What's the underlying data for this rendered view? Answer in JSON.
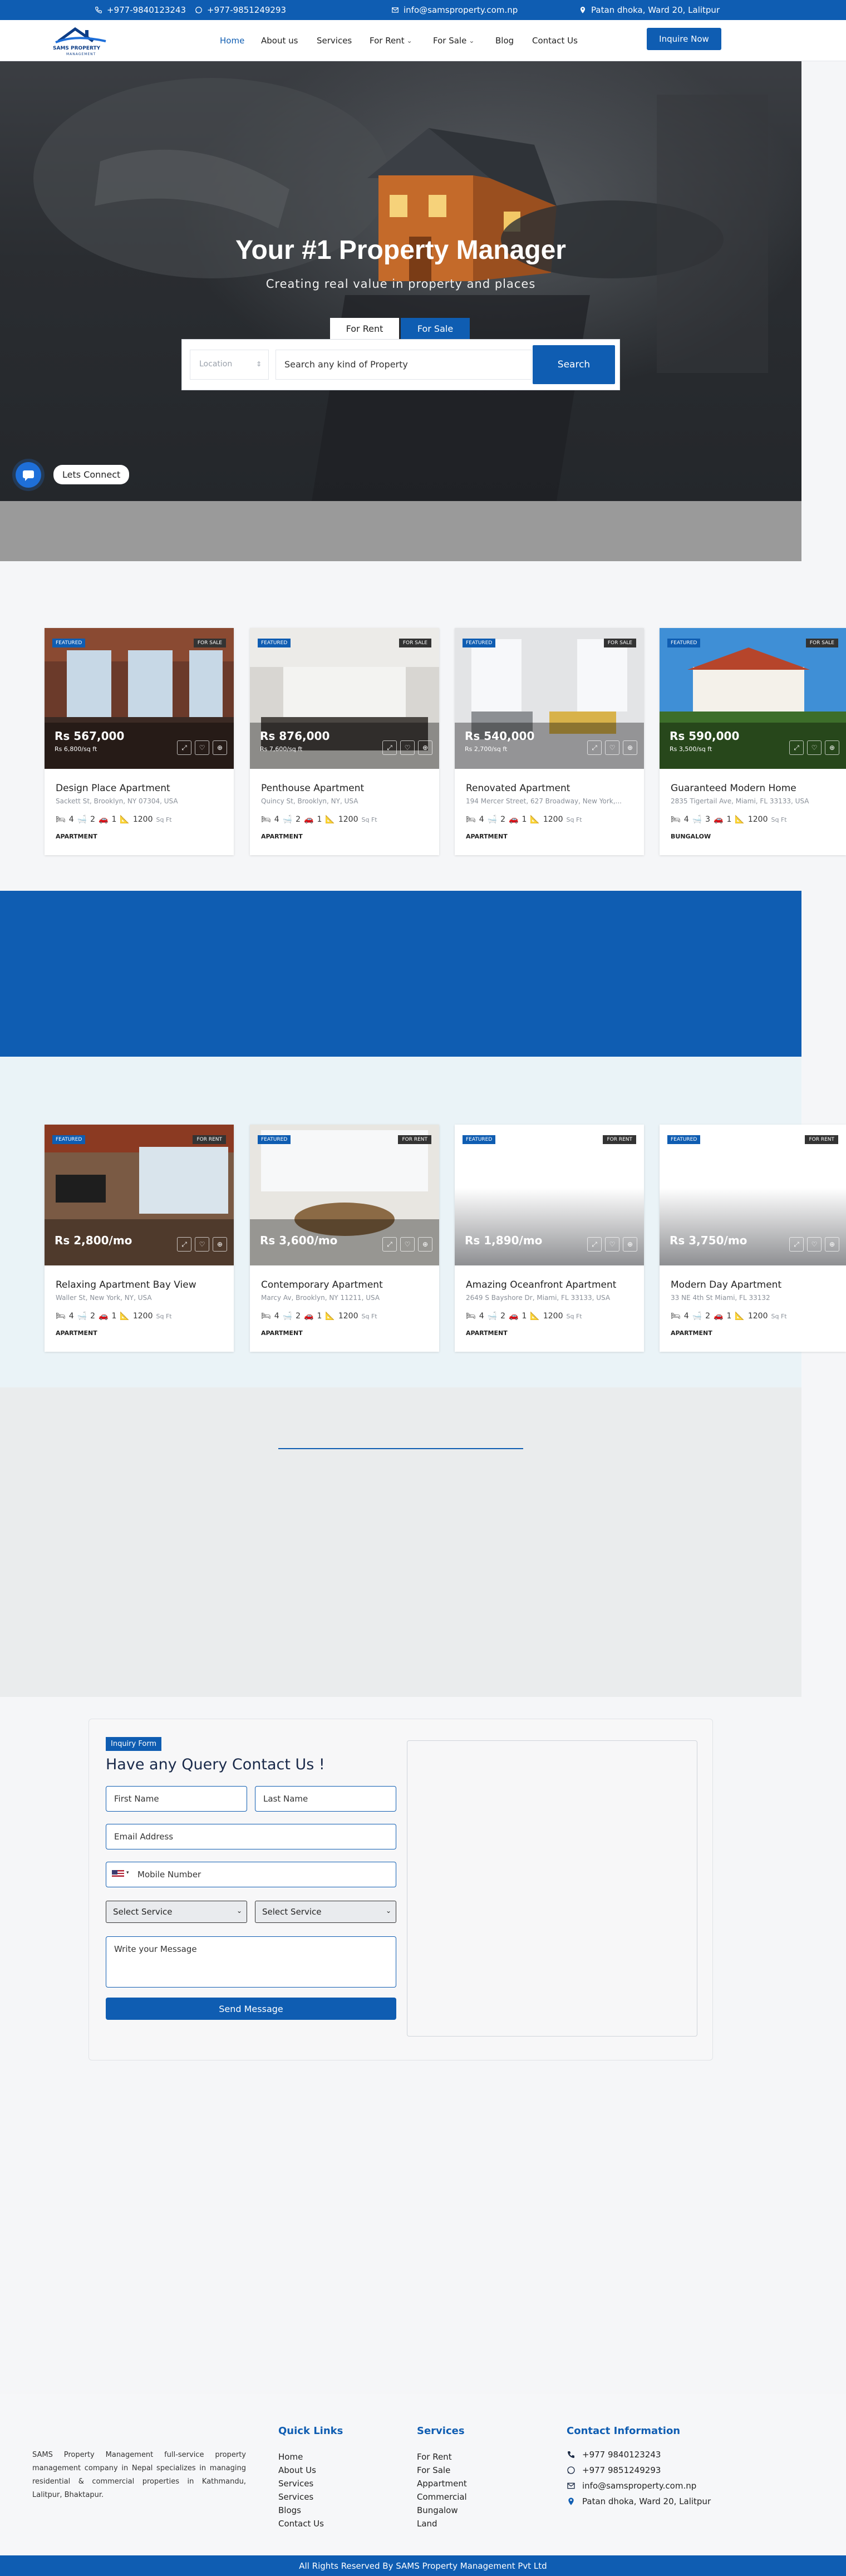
{
  "topbar": {
    "phone1": "+977-9840123243",
    "phone2": "+977-9851249293",
    "email": "info@samsproperty.com.np",
    "address": "Patan dhoka, Ward 20, Lalitpur"
  },
  "nav": {
    "logo_text": "SAMS PROPERTY",
    "logo_subtext": "MANAGEMENT",
    "items": [
      "Home",
      "About us",
      "Services",
      "For Rent",
      "For Sale",
      "Blog",
      "Contact Us"
    ],
    "inquire_label": "Inquire Now"
  },
  "hero": {
    "title": "Your #1 Property Manager",
    "subtitle": "Creating real value in property and places",
    "tab_rent": "For Rent",
    "tab_sale": "For Sale",
    "location_placeholder": "Location",
    "search_placeholder": "Search any kind of Property",
    "search_button": "Search",
    "connect_label": "Lets Connect"
  },
  "sale_listings": [
    {
      "featured": "FEATURED",
      "type": "FOR SALE",
      "price": "Rs 567,000",
      "sqft": "Rs 6,800/sq ft",
      "title": "Design Place Apartment",
      "address": "Sackett St, Brooklyn, NY 07304, USA",
      "beds": "4",
      "baths": "2",
      "garage": "1",
      "area": "1200",
      "unit": "Sq Ft",
      "category": "APARTMENT"
    },
    {
      "featured": "FEATURED",
      "type": "FOR SALE",
      "price": "Rs 876,000",
      "sqft": "Rs 7,600/sq ft",
      "title": "Penthouse Apartment",
      "address": "Quincy St, Brooklyn, NY, USA",
      "beds": "4",
      "baths": "2",
      "garage": "1",
      "area": "1200",
      "unit": "Sq Ft",
      "category": "APARTMENT"
    },
    {
      "featured": "FEATURED",
      "type": "FOR SALE",
      "price": "Rs 540,000",
      "sqft": "Rs 2,700/sq ft",
      "title": "Renovated Apartment",
      "address": "194 Mercer Street, 627 Broadway, New York,...",
      "beds": "4",
      "baths": "2",
      "garage": "1",
      "area": "1200",
      "unit": "Sq Ft",
      "category": "APARTMENT"
    },
    {
      "featured": "FEATURED",
      "type": "FOR SALE",
      "price": "Rs 590,000",
      "sqft": "Rs 3,500/sq ft",
      "title": "Guaranteed Modern Home",
      "address": "2835 Tigertail Ave, Miami, FL 33133, USA",
      "beds": "4",
      "baths": "3",
      "garage": "1",
      "area": "1200",
      "unit": "Sq Ft",
      "category": "BUNGALOW"
    }
  ],
  "rent_listings": [
    {
      "featured": "FEATURED",
      "type": "FOR RENT",
      "price": "Rs 2,800/mo",
      "title": "Relaxing Apartment Bay View",
      "address": "Waller St, New York, NY, USA",
      "beds": "4",
      "baths": "2",
      "garage": "1",
      "area": "1200",
      "unit": "Sq Ft",
      "category": "APARTMENT"
    },
    {
      "featured": "FEATURED",
      "type": "FOR RENT",
      "price": "Rs 3,600/mo",
      "title": "Contemporary Apartment",
      "address": "Marcy Av, Brooklyn, NY 11211, USA",
      "beds": "4",
      "baths": "2",
      "garage": "1",
      "area": "1200",
      "unit": "Sq Ft",
      "category": "APARTMENT"
    },
    {
      "featured": "FEATURED",
      "type": "FOR RENT",
      "price": "Rs 1,890/mo",
      "title": "Amazing Oceanfront Apartment",
      "address": "2649 S Bayshore Dr, Miami, FL 33133, USA",
      "beds": "4",
      "baths": "2",
      "garage": "1",
      "area": "1200",
      "unit": "Sq Ft",
      "category": "APARTMENT"
    },
    {
      "featured": "FEATURED",
      "type": "FOR RENT",
      "price": "Rs 3,750/mo",
      "title": "Modern Day Apartment",
      "address": "33 NE 4th St Miami, FL 33132",
      "beds": "4",
      "baths": "2",
      "garage": "1",
      "area": "1200",
      "unit": "Sq Ft",
      "category": "APARTMENT"
    }
  ],
  "inquiry": {
    "badge": "Inquiry Form",
    "title": "Have any Query Contact Us !",
    "first_name": "First Name",
    "last_name": "Last Name",
    "email": "Email Address",
    "mobile": "Mobile Number",
    "service1": "Select Service",
    "service2": "Select Service",
    "message": "Write your Message",
    "send": "Send Message"
  },
  "footer": {
    "about": "SAMS Property Management full-service property management company in Nepal specializes in managing residential & commercial properties in Kathmandu, Lalitpur, Bhaktapur.",
    "quick_links_title": "Quick Links",
    "quick_links": [
      "Home",
      "About Us",
      "Services",
      "Services",
      "Blogs",
      "Contact Us"
    ],
    "services_title": "Services",
    "services": [
      "For Rent",
      "For Sale",
      "Appartment",
      "Commercial",
      "Bungalow",
      "Land"
    ],
    "contact_title": "Contact Information",
    "contact_phone1": "+977 9840123243",
    "contact_phone2": "+977 9851249293",
    "contact_email": "info@samsproperty.com.np",
    "contact_address": "Patan dhoka, Ward 20, Lalitpur",
    "copyright": "All Rights Reserved By SAMS Property Management Pvt Ltd"
  },
  "colors": {
    "brand": "#0f5db2",
    "dark": "#222222"
  }
}
